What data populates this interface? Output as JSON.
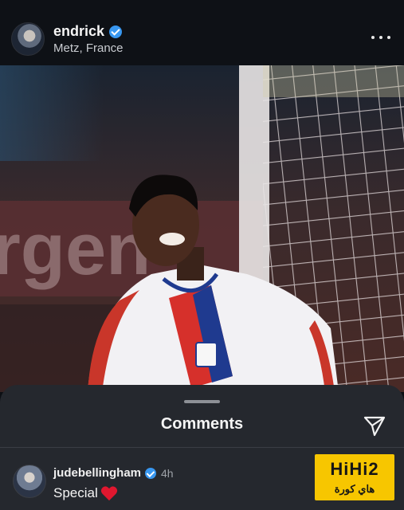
{
  "post": {
    "username": "endrick",
    "location": "Metz, France",
    "verified": true
  },
  "photo": {
    "description_icon": "photo",
    "banner_text": "rgen"
  },
  "comments_sheet": {
    "title": "Comments",
    "comments": [
      {
        "username": "judebellingham",
        "verified": true,
        "time": "4h",
        "text": "Special",
        "emoji": "red-heart"
      }
    ]
  },
  "watermark": {
    "main": "HiHi2",
    "sub": "هاي كورة"
  },
  "colors": {
    "background": "#0c0f14",
    "sheet": "#25282e",
    "verified_blue": "#3897f0",
    "watermark_yellow": "#f7c600",
    "heart_red": "#e0172f"
  }
}
